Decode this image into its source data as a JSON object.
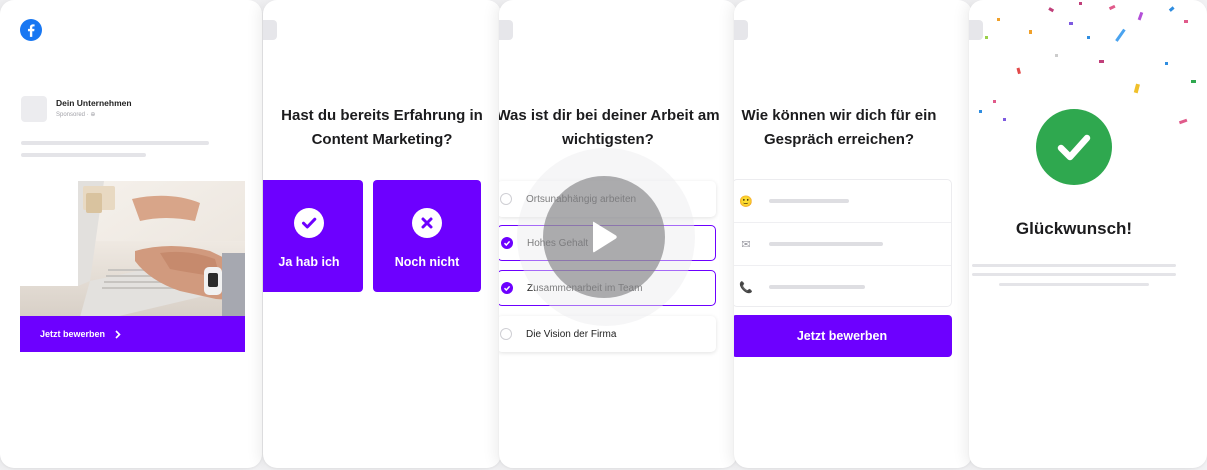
{
  "colors": {
    "accent": "#6d00ff",
    "facebook_blue": "#1877f2",
    "success_green": "#2fa84f"
  },
  "ad": {
    "company_name": "Dein Unternehmen",
    "sponsored_label": "Sponsored · ⊕",
    "cta_label": "Jetzt bewerben",
    "cta_icon": "chevron-right-icon"
  },
  "step1": {
    "question": "Hast du bereits Erfahrung in Content Marketing?",
    "options": [
      {
        "label": "Ja hab ich",
        "icon": "check-circle-icon"
      },
      {
        "label": "Noch nicht",
        "icon": "x-circle-icon"
      }
    ]
  },
  "step2": {
    "question": "Was ist dir bei deiner Arbeit am wichtigsten?",
    "options": [
      {
        "label": "Ortsunabhängig arbeiten",
        "selected": false
      },
      {
        "label": "Hohes Gehalt",
        "selected": true
      },
      {
        "label": "Zusammenarbeit im Team",
        "selected": true
      },
      {
        "label": "Die Vision der Firma",
        "selected": false
      }
    ],
    "video_icon": "play-icon"
  },
  "step3": {
    "question": "Wie können wir dich für ein Gespräch erreichen?",
    "fields": [
      {
        "icon": "smiley-icon",
        "glyph": "🙂"
      },
      {
        "icon": "envelope-icon",
        "glyph": "✉"
      },
      {
        "icon": "phone-icon",
        "glyph": "📞"
      }
    ],
    "submit_label": "Jetzt bewerben"
  },
  "done": {
    "title": "Glückwunsch!",
    "icon": "check-circle-icon"
  }
}
